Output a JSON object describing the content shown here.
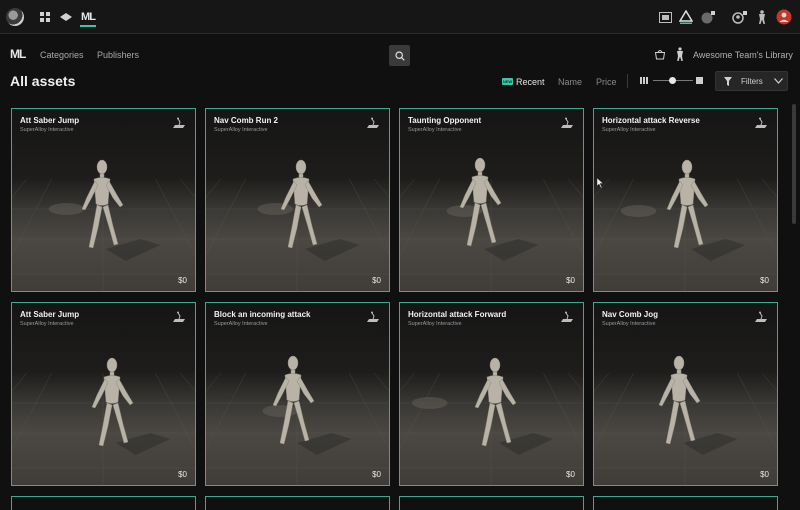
{
  "topbar": {
    "left_icons": [
      "app-logo-icon",
      "apps-grid-icon",
      "diamond-icon",
      "ml-icon"
    ],
    "ml_label": "ML",
    "right_icons": [
      "media-icon",
      "asset-manager-icon",
      "lock-circle-icon",
      "account-lock-icon",
      "person-icon",
      "user-avatar-icon"
    ],
    "accent": "#3fc4a6",
    "avatar_color": "#c0392b"
  },
  "nav": {
    "logo": "ML",
    "categories": "Categories",
    "publishers": "Publishers",
    "library": "Awesome Team's Library"
  },
  "page": {
    "title": "All assets"
  },
  "sort": {
    "recent": "Recent",
    "name": "Name",
    "price": "Price",
    "new_badge": "NEW"
  },
  "filters": {
    "label": "Filters"
  },
  "cards": [
    {
      "name": "Att Saber Jump",
      "publisher": "SuperAlloy Interactive",
      "price": "$0"
    },
    {
      "name": "Nav Comb Run 2",
      "publisher": "SuperAlloy Interactive",
      "price": "$0"
    },
    {
      "name": "Taunting Opponent",
      "publisher": "SuperAlloy Interactive",
      "price": "$0"
    },
    {
      "name": "Horizontal attack Reverse",
      "publisher": "SuperAlloy Interactive",
      "price": "$0"
    },
    {
      "name": "Att Saber Jump",
      "publisher": "SuperAlloy Interactive",
      "price": "$0"
    },
    {
      "name": "Block an incoming attack",
      "publisher": "SuperAlloy Interactive",
      "price": "$0"
    },
    {
      "name": "Horizontal attack Forward",
      "publisher": "SuperAlloy Interactive",
      "price": "$0"
    },
    {
      "name": "Nav Comb Jog",
      "publisher": "SuperAlloy Interactive",
      "price": "$0"
    }
  ]
}
